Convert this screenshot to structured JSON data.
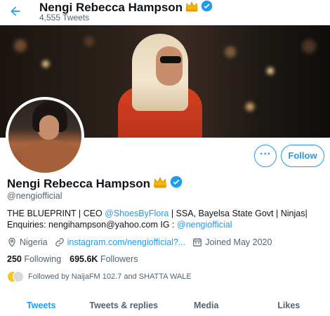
{
  "header": {
    "name": "Nengi Rebecca Hampson",
    "tweet_count": "4,555 Tweets"
  },
  "profile": {
    "name": "Nengi Rebecca Hampson",
    "handle": "@nengiofficial",
    "bio_prefix": "THE BLUEPRINT | CEO ",
    "bio_link1": "@ShoesByFlora",
    "bio_middle": " | SSA, Bayelsa State Govt | Ninjas| Enquiries: nengihampson@yahoo.com IG : ",
    "bio_link2": "@nengiofficial",
    "location": "Nigeria",
    "website": "instagram.com/nengiofficial?...",
    "joined": "Joined May 2020",
    "following_count": "250",
    "following_label": "Following",
    "followers_count": "695.6K",
    "followers_label": "Followers",
    "followed_by": "Followed by NaijaFM 102.7 and SHATTA WALE"
  },
  "actions": {
    "more_label": "···",
    "follow_label": "Follow"
  },
  "tabs": [
    {
      "label": "Tweets"
    },
    {
      "label": "Tweets & replies"
    },
    {
      "label": "Media"
    },
    {
      "label": "Likes"
    }
  ],
  "colors": {
    "accent": "#1d9bf0",
    "text": "#0f1419",
    "muted": "#536471",
    "verified": "#1d9bf0",
    "crown": "#f4b400"
  },
  "icons": {
    "back": "back-arrow-icon",
    "crown": "crown-emoji-icon",
    "verified": "verified-badge-icon",
    "location": "location-pin-icon",
    "link": "link-icon",
    "calendar": "calendar-icon"
  }
}
